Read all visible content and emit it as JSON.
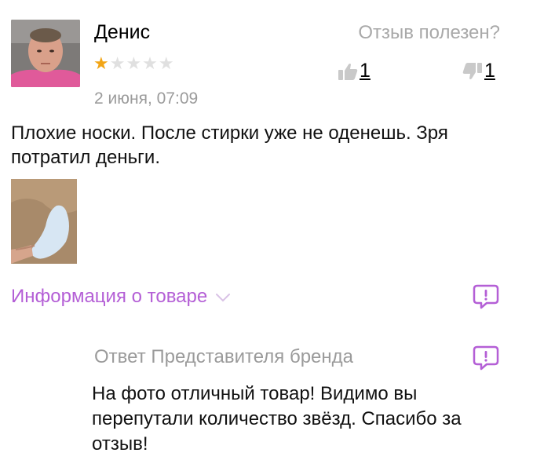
{
  "review": {
    "author": "Денис",
    "rating": 1,
    "max_rating": 5,
    "stars_filled": "★",
    "stars_empty": "★★★★",
    "date": "2 июня, 07:09",
    "text": "Плохие носки. После стирки уже не оденешь. Зря потратил деньги.",
    "photo_icon": "photo-thumbnail"
  },
  "helpful": {
    "label": "Отзыв полезен?",
    "likes": "1",
    "dislikes": "1"
  },
  "product_info": {
    "label": "Информация о товаре"
  },
  "brand_reply": {
    "title": "Ответ Представителя бренда",
    "text": "На фото отличный товар! Видимо вы перепутали количество звёзд. Спасибо за отзыв!"
  },
  "colors": {
    "accent": "#b45fd6",
    "star": "#f2a516",
    "muted": "#9b9b9b"
  }
}
